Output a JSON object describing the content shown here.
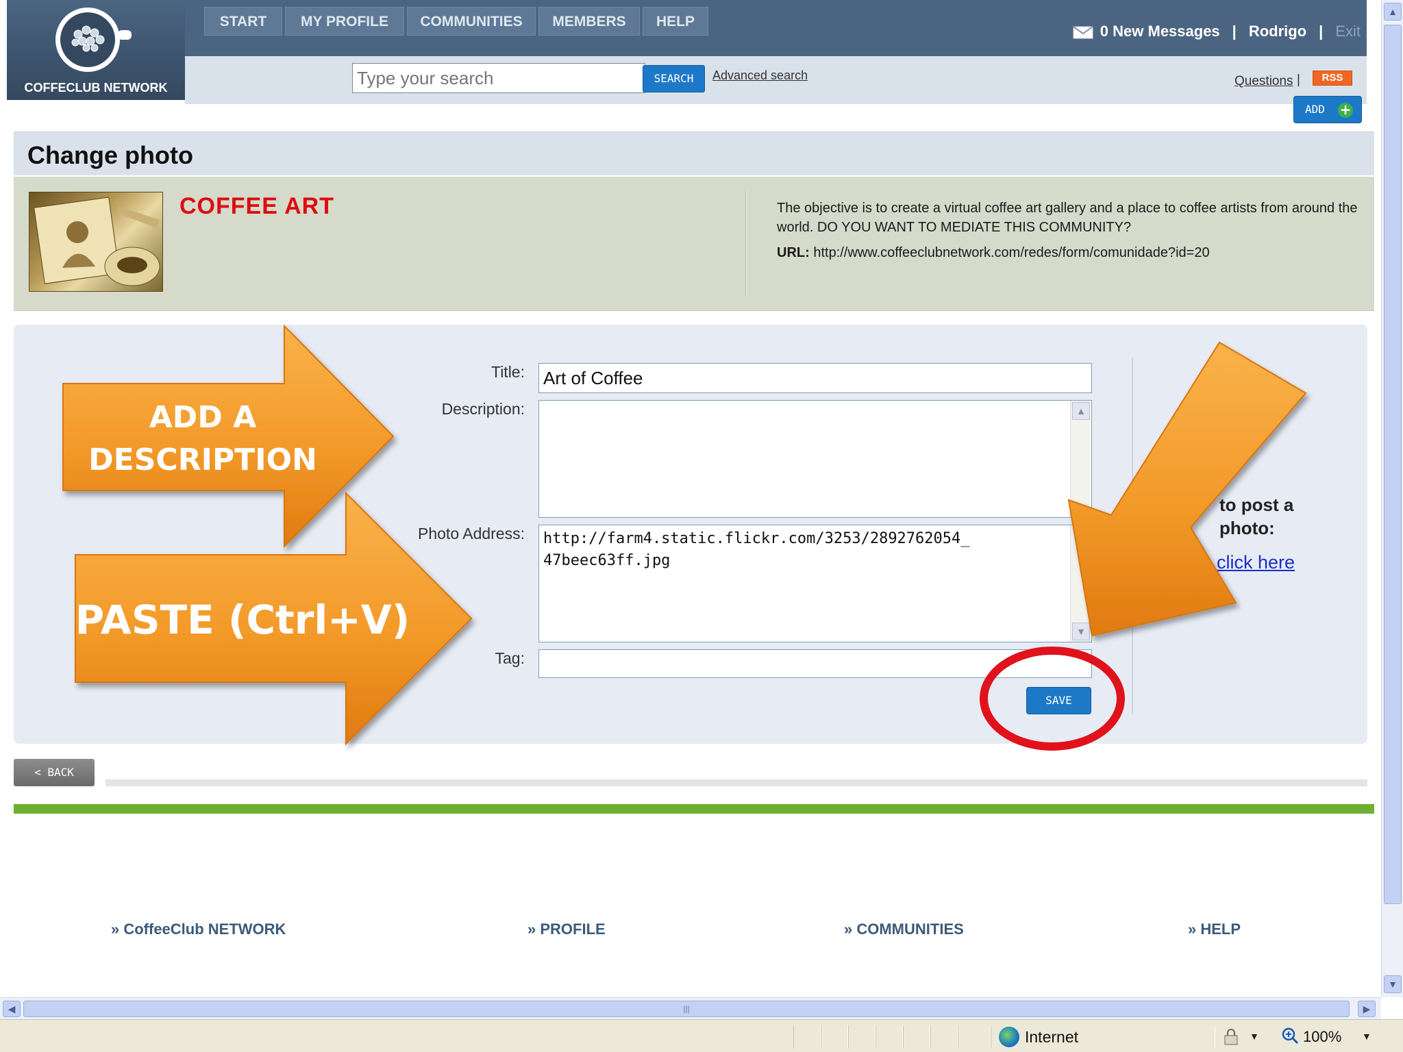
{
  "brand": {
    "name": "COFFECLUB NETWORK"
  },
  "nav": {
    "tabs": [
      "START",
      "MY PROFILE",
      "COMMUNITIES",
      "MEMBERS",
      "HELP"
    ]
  },
  "user_bar": {
    "messages": "0 New Messages",
    "separator": "|",
    "username": "Rodrigo",
    "exit": "Exit"
  },
  "search": {
    "placeholder": "Type your search",
    "button": "SEARCH",
    "advanced": "Advanced search"
  },
  "utility": {
    "questions": "Questions",
    "questions_sep": "|",
    "rss": "RSS",
    "add": "ADD"
  },
  "page": {
    "title": "Change photo"
  },
  "community": {
    "name": "COFFEE ART",
    "description": "The objective is to create a virtual coffee art gallery and a place to coffee artists from around the world. DO YOU WANT TO MEDIATE THIS COMMUNITY?",
    "url_label": "URL:",
    "url": "http://www.coffeeclubnetwork.com/redes/form/comunidade?id=20"
  },
  "form": {
    "title_label": "Title:",
    "title_value": "Art of Coffee",
    "description_label": "Description:",
    "description_value": "",
    "photo_label": "Photo Address:",
    "photo_value": "http://farm4.static.flickr.com/3253/2892762054_\n47beec63ff.jpg",
    "tag_label": "Tag:",
    "tag_value": "",
    "save": "SAVE"
  },
  "sidebar_hint": {
    "text_line1": "to post a",
    "text_line2": "photo:",
    "link": "click here"
  },
  "annotations": {
    "arrow1_line1": "ADD A",
    "arrow1_line2": "DESCRIPTION",
    "arrow2": "PASTE (Ctrl+V)",
    "arrow_color": "#f39a2a",
    "circle_color": "#e0121b"
  },
  "navigation": {
    "back": "< BACK"
  },
  "footer": {
    "links": [
      "» CoffeeClub NETWORK",
      "» PROFILE",
      "» COMMUNITIES",
      "» HELP"
    ]
  },
  "browser": {
    "zone": "Internet",
    "zoom": "100%"
  },
  "colors": {
    "header": "#4b6481",
    "accent_blue": "#1d79c8",
    "green_rule": "#6cb033",
    "community_name": "#dd0d0d"
  }
}
